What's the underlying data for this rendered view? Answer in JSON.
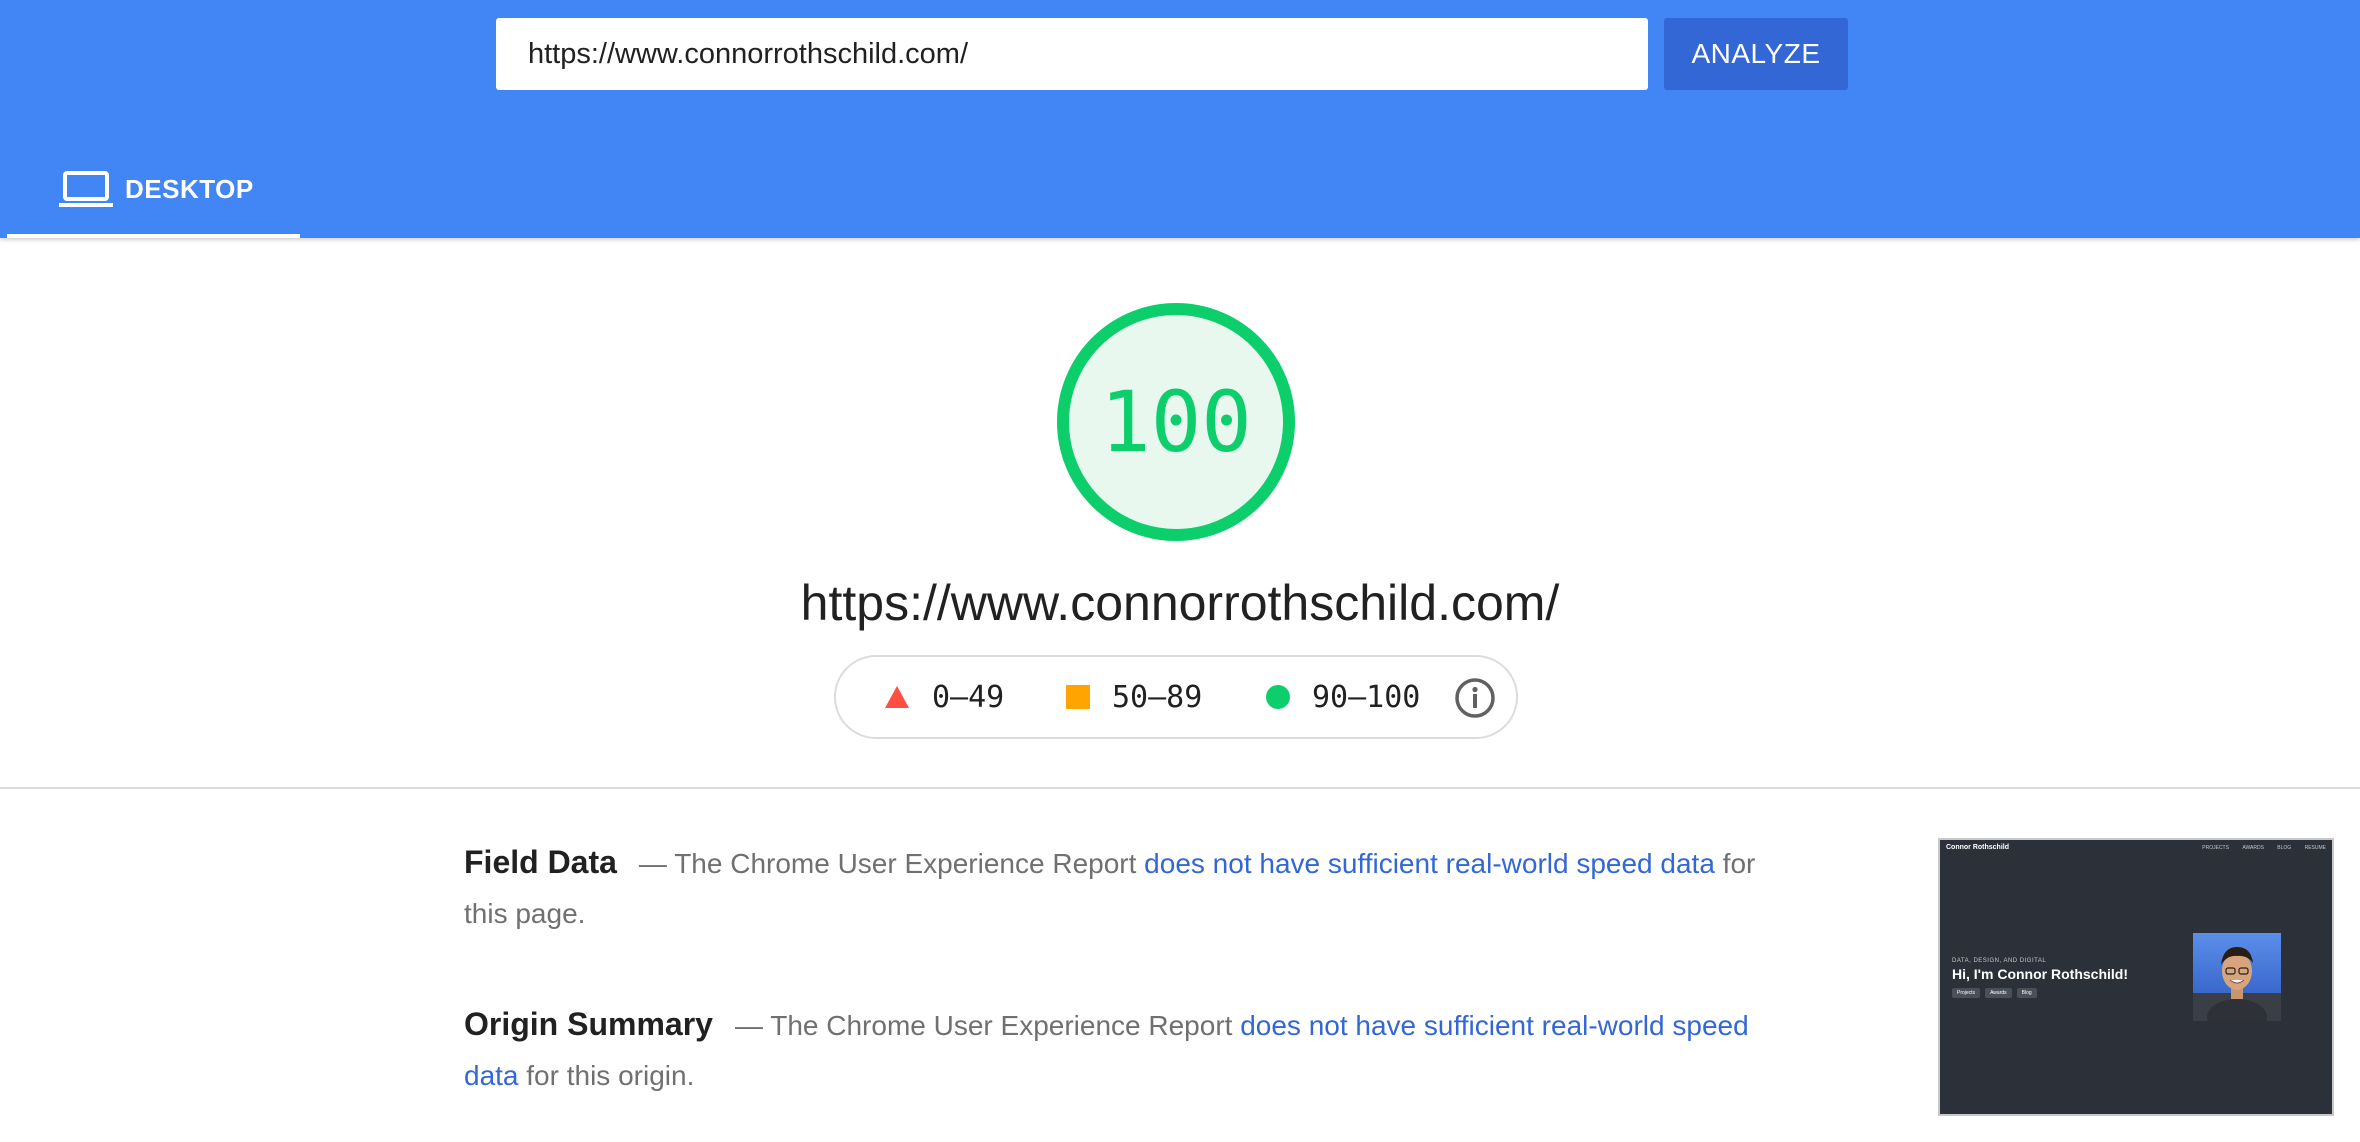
{
  "search": {
    "url_value": "https://www.connorrothschild.com/",
    "analyze_label": "ANALYZE"
  },
  "tabs": [
    {
      "label": "DESKTOP",
      "icon": "laptop-icon",
      "selected": true
    }
  ],
  "score": {
    "value": "100",
    "fraction": 1.0,
    "color": "#0cce6b"
  },
  "tested_url": "https://www.connorrothschild.com/",
  "legend": [
    {
      "label": "0–49",
      "icon": "red-triangle-icon",
      "color": "#ff4e42"
    },
    {
      "label": "50–89",
      "icon": "orange-square-icon",
      "color": "#ffa400"
    },
    {
      "label": "90–100",
      "icon": "green-circle-icon",
      "color": "#0cce6b"
    }
  ],
  "sections": {
    "field_data": {
      "heading": "Field Data",
      "prefix": "— The Chrome User Experience Report ",
      "link": "does not have sufficient real-world speed data",
      "suffix": " for this page."
    },
    "origin_summary": {
      "heading": "Origin Summary",
      "prefix": "— The Chrome User Experience Report ",
      "link": "does not have sufficient real-world speed data",
      "suffix": " for this origin."
    }
  },
  "screenshot": {
    "brand": "Connor Rothschild",
    "nav": [
      "PROJECTS",
      "AWARDS",
      "BLOG",
      "RESUME"
    ],
    "kicker": "DATA, DESIGN, AND DIGITAL",
    "title": "Hi, I'm Connor Rothschild!",
    "buttons": [
      "Projects",
      "Awards",
      "Blog"
    ]
  },
  "colors": {
    "header": "#4285f4",
    "accent_button": "#3367d6",
    "link": "#3367d6"
  }
}
